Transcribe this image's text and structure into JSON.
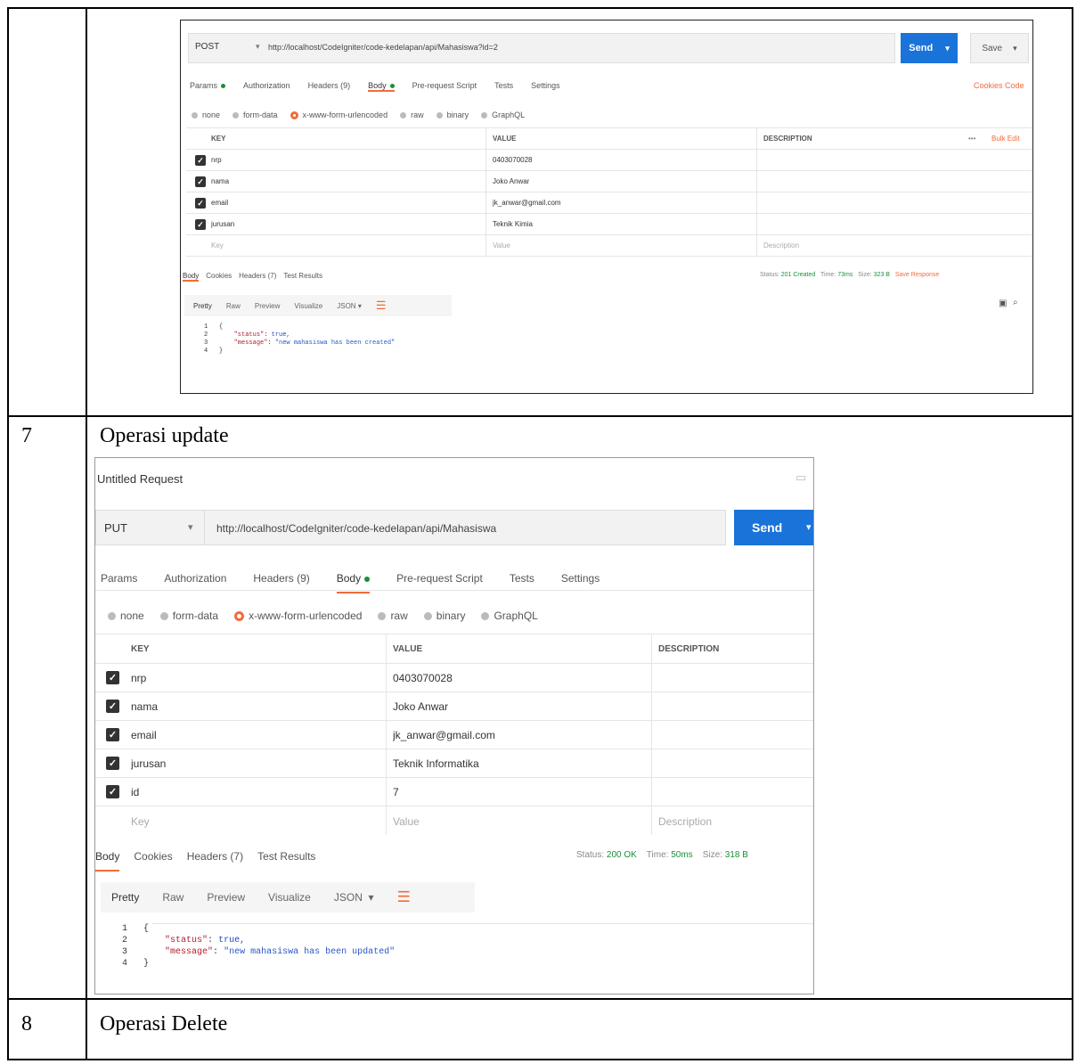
{
  "rows": [
    {
      "num": "",
      "title": ""
    },
    {
      "num": "7",
      "title": "Operasi update"
    },
    {
      "num": "8",
      "title": "Operasi Delete"
    }
  ],
  "post_request": {
    "method": "POST",
    "url": "http://localhost/CodeIgniter/code-kedelapan/api/Mahasiswa?id=2",
    "send_label": "Send",
    "save_label": "Save",
    "tabs": [
      "Params",
      "Authorization",
      "Headers (9)",
      "Body",
      "Pre-request Script",
      "Tests",
      "Settings"
    ],
    "right_links": "Cookies  Code",
    "body_types": [
      "none",
      "form-data",
      "x-www-form-urlencoded",
      "raw",
      "binary",
      "GraphQL"
    ],
    "selected_body_type": "x-www-form-urlencoded",
    "columns": [
      "KEY",
      "VALUE",
      "DESCRIPTION"
    ],
    "bulk_edit": "Bulk Edit",
    "params": [
      {
        "key": "nrp",
        "value": "0403070028"
      },
      {
        "key": "nama",
        "value": "Joko Anwar"
      },
      {
        "key": "email",
        "value": "jk_anwar@gmail.com"
      },
      {
        "key": "jurusan",
        "value": "Teknik Kimia"
      }
    ],
    "placeholders": {
      "key": "Key",
      "value": "Value",
      "description": "Description"
    },
    "response_tabs": [
      "Body",
      "Cookies",
      "Headers (7)",
      "Test Results"
    ],
    "status": {
      "label": "Status:",
      "value": "201 Created",
      "time_label": "Time:",
      "time": "73ms",
      "size_label": "Size:",
      "size": "323 B",
      "save_response": "Save Response"
    },
    "format_tabs": [
      "Pretty",
      "Raw",
      "Preview",
      "Visualize",
      "JSON"
    ],
    "code_lines": [
      {
        "n": "1",
        "text": "{"
      },
      {
        "n": "2",
        "key": "\"status\"",
        "val": " true,"
      },
      {
        "n": "3",
        "key": "\"message\"",
        "val": " \"new mahasiswa has been created\""
      },
      {
        "n": "4",
        "text": "}"
      }
    ]
  },
  "put_request": {
    "title": "Untitled Request",
    "method": "PUT",
    "url": "http://localhost/CodeIgniter/code-kedelapan/api/Mahasiswa",
    "send_label": "Send",
    "tabs": [
      "Params",
      "Authorization",
      "Headers (9)",
      "Body",
      "Pre-request Script",
      "Tests",
      "Settings"
    ],
    "body_types": [
      "none",
      "form-data",
      "x-www-form-urlencoded",
      "raw",
      "binary",
      "GraphQL"
    ],
    "selected_body_type": "x-www-form-urlencoded",
    "columns": [
      "KEY",
      "VALUE",
      "DESCRIPTION"
    ],
    "params": [
      {
        "key": "nrp",
        "value": "0403070028"
      },
      {
        "key": "nama",
        "value": "Joko Anwar"
      },
      {
        "key": "email",
        "value": "jk_anwar@gmail.com"
      },
      {
        "key": "jurusan",
        "value": "Teknik Informatika"
      },
      {
        "key": "id",
        "value": "7"
      }
    ],
    "placeholders": {
      "key": "Key",
      "value": "Value",
      "description": "Description"
    },
    "response_tabs": [
      "Body",
      "Cookies",
      "Headers (7)",
      "Test Results"
    ],
    "status": {
      "label": "Status:",
      "value": "200 OK",
      "time_label": "Time:",
      "time": "50ms",
      "size_label": "Size:",
      "size": "318 B"
    },
    "format_tabs": [
      "Pretty",
      "Raw",
      "Preview",
      "Visualize",
      "JSON"
    ],
    "code_lines": [
      {
        "n": "1",
        "text": "{"
      },
      {
        "n": "2",
        "key": "\"status\"",
        "val": " true,"
      },
      {
        "n": "3",
        "key": "\"message\"",
        "val": " \"new mahasiswa has been updated\""
      },
      {
        "n": "4",
        "text": "}"
      }
    ]
  }
}
